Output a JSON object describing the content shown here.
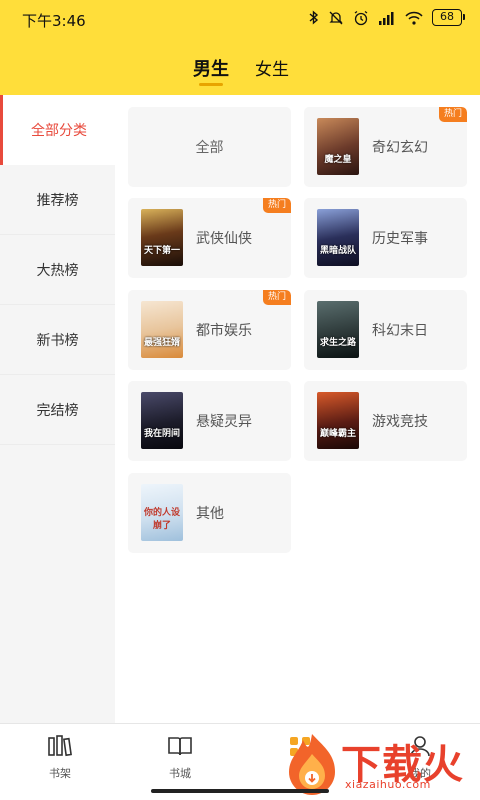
{
  "status_bar": {
    "time": "下午3:46",
    "battery": "68"
  },
  "tabs": [
    {
      "label": "男生",
      "active": true
    },
    {
      "label": "女生",
      "active": false
    }
  ],
  "sidebar": {
    "items": [
      {
        "label": "全部分类",
        "active": true
      },
      {
        "label": "推荐榜",
        "active": false
      },
      {
        "label": "大热榜",
        "active": false
      },
      {
        "label": "新书榜",
        "active": false
      },
      {
        "label": "完结榜",
        "active": false
      }
    ]
  },
  "categories": [
    {
      "label": "全部",
      "hot": false
    },
    {
      "label": "奇幻玄幻",
      "hot": true,
      "badge": "热门",
      "cover_text": "魔之皇",
      "cover_color": "#6b3a2a"
    },
    {
      "label": "武侠仙侠",
      "hot": true,
      "badge": "热门",
      "cover_text": "天下第一",
      "cover_color": "#3a2218"
    },
    {
      "label": "历史军事",
      "hot": false,
      "cover_text": "黑暗战队",
      "cover_color": "#2a2f5a"
    },
    {
      "label": "都市娱乐",
      "hot": true,
      "badge": "热门",
      "cover_text": "最强狂婿",
      "cover_color": "#e8c59c"
    },
    {
      "label": "科幻末日",
      "hot": false,
      "cover_text": "求生之路",
      "cover_color": "#2e3a3a"
    },
    {
      "label": "悬疑灵异",
      "hot": false,
      "cover_text": "我在阴间",
      "cover_color": "#1c1c2a"
    },
    {
      "label": "游戏竞技",
      "hot": false,
      "cover_text": "巅峰霸主",
      "cover_color": "#5a1c14"
    },
    {
      "label": "其他",
      "hot": false,
      "cover_text": "你的人设崩了",
      "cover_color": "#cfe0ef"
    }
  ],
  "bottom_nav": [
    {
      "label": "书架",
      "icon": "bookshelf-icon"
    },
    {
      "label": "书城",
      "icon": "open-book-icon"
    },
    {
      "label": "分类",
      "icon": "category-icon"
    },
    {
      "label": "我的",
      "icon": "profile-icon"
    }
  ],
  "watermark": {
    "title": "下载火",
    "url": "xiazaihuo.com"
  }
}
